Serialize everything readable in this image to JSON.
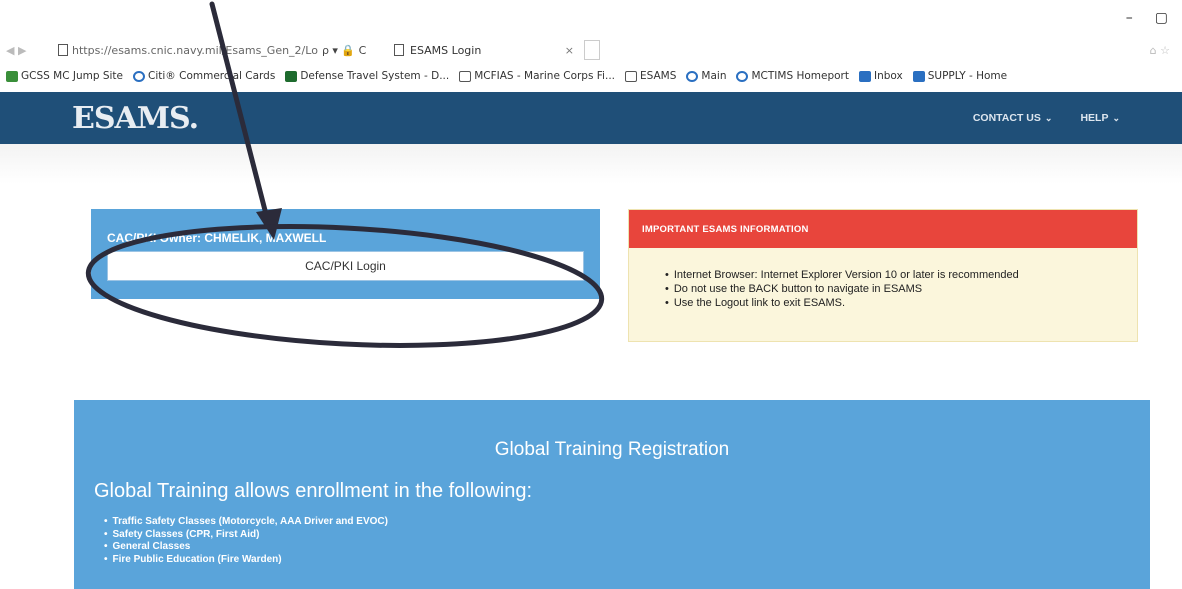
{
  "window": {
    "minimize": "–",
    "restore": "▢"
  },
  "addressbar": {
    "url": "https://esams.cnic.navy.mil/Esams_Gen_2/Lo",
    "url_icons": "ρ ▾ 🔒 C",
    "tab_title": "ESAMS Login",
    "tab_close": "×"
  },
  "favorites": [
    {
      "label": "GCSS MC Jump Site",
      "icon": "green-square-icon"
    },
    {
      "label": "Citi® Commercial Cards",
      "icon": "ie-icon"
    },
    {
      "label": "Defense Travel System - D...",
      "icon": "travel-icon"
    },
    {
      "label": "MCFIAS - Marine Corps Fi...",
      "icon": "doc-icon"
    },
    {
      "label": "ESAMS",
      "icon": "doc-icon"
    },
    {
      "label": "Main",
      "icon": "ie-icon"
    },
    {
      "label": "MCTIMS Homeport",
      "icon": "ie-icon"
    },
    {
      "label": "Inbox",
      "icon": "inbox-icon"
    },
    {
      "label": "SUPPLY - Home",
      "icon": "blue-square-icon"
    }
  ],
  "header": {
    "logo": "ESAMS.",
    "nav": [
      {
        "label": "CONTACT US",
        "chevron": "⌄"
      },
      {
        "label": "HELP",
        "chevron": "⌄"
      }
    ]
  },
  "login": {
    "owner": "CAC/PKI Owner: CHMELIK, MAXWELL",
    "button": "CAC/PKI Login"
  },
  "info": {
    "heading": "IMPORTANT ESAMS INFORMATION",
    "items": [
      "Internet Browser: Internet Explorer Version 10 or later is recommended",
      "Do not use the BACK button to navigate in ESAMS",
      "Use the Logout link to exit ESAMS."
    ]
  },
  "global_training": {
    "title": "Global Training Registration",
    "subtitle": "Global Training allows enrollment in the following:",
    "items": [
      "Traffic Safety Classes (Motorcycle, AAA Driver and EVOC)",
      "Safety Classes (CPR, First Aid)",
      "General Classes",
      "Fire Public Education (Fire Warden)"
    ]
  },
  "colors": {
    "header_bg": "#1f4f78",
    "panel_blue": "#5aa4da",
    "alert_red": "#e8453c",
    "alert_body": "#fbf6dc",
    "annotation_ink": "#2b2b3a"
  }
}
